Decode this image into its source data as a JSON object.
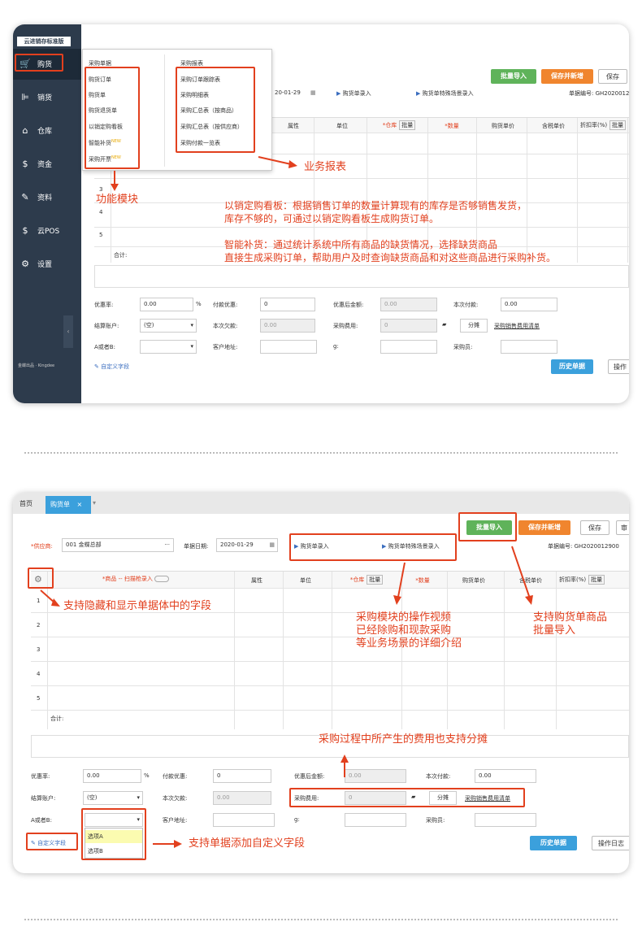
{
  "card1": {
    "brand": "云进销存标准版",
    "nav": [
      {
        "label": "购货",
        "icon": "cart-icon"
      },
      {
        "label": "销货",
        "icon": "sales-icon"
      },
      {
        "label": "仓库",
        "icon": "warehouse-icon"
      },
      {
        "label": "资金",
        "icon": "money-icon"
      },
      {
        "label": "资料",
        "icon": "pencil-icon"
      },
      {
        "label": "云POS",
        "icon": "pos-icon"
      },
      {
        "label": "设置",
        "icon": "gear-icon"
      }
    ],
    "footer": "金蝶出品 · Kingdee",
    "menu": {
      "col1_title": "采购单据",
      "col1": [
        "购货订单",
        "购货单",
        "购货退货单",
        "以销定购看板",
        "智能补货",
        "采购开票"
      ],
      "new": "NEW",
      "col2_title": "采购报表",
      "col2": [
        "采购订单跟踪表",
        "采购明细表",
        "采购汇总表（按商品）",
        "采购汇总表（按供应商）",
        "采购付款一览表"
      ]
    },
    "buttons": {
      "import": "批量导入",
      "save_new": "保存并新增",
      "save": "保存",
      "history": "历史单据",
      "op": "操作"
    },
    "date": "20-01-29",
    "video1": "购货单录入",
    "video2": "购货单特殊场景录入",
    "docno": "单据编号:  GH2020012",
    "columns": [
      "属性",
      "单位",
      "*仓库",
      "*数量",
      "购货单价",
      "含税单价",
      "折扣率(%)"
    ],
    "batch": "批量",
    "rows": [
      "3",
      "4",
      "5"
    ],
    "total": "合计:",
    "footer_form": {
      "discount_label": "优惠率:",
      "discount": "0.00",
      "pct": "%",
      "pay_disc_label": "付款优惠:",
      "pay_disc": "0",
      "after_label": "优惠后金额:",
      "after": "0.00",
      "this_pay_label": "本次付款:",
      "this_pay": "0.00",
      "account_label": "结算账户:",
      "account": "(空)",
      "owe_label": "本次欠款:",
      "owe": "0.00",
      "fee_label": "采购费用:",
      "fee": "0",
      "split": "分摊",
      "fee_list": "采购销售费用清单",
      "ab_label": "A或者B:",
      "addr_label": "客户地址:",
      "g_label": "g:",
      "buyer_label": "采购员:",
      "custom": "自定义字段"
    },
    "ann": {
      "func": "功能模块",
      "report": "业务报表",
      "p1": "以销定购看板：根据销售订单的数量计算现有的库存是否够销售发货，",
      "p2": "库存不够的，可通过以销定购看板生成购货订单。",
      "p3": "智能补货：通过统计系统中所有商品的缺货情况，选择缺货商品",
      "p4": "直接生成采购订单，帮助用户及时查询缺货商品和对这些商品进行采购补货。"
    }
  },
  "card2": {
    "tabs": [
      "首页",
      "购货单"
    ],
    "close": "×",
    "buttons": {
      "import": "批量导入",
      "save_new": "保存并新增",
      "save": "保存",
      "more": "审",
      "history": "历史单据",
      "log": "操作日志"
    },
    "supplier_label": "*供应商:",
    "supplier": "001 金蝶总部",
    "dots": "···",
    "date_label": "单据日期:",
    "date": "2020-01-29",
    "video1": "购货单录入",
    "video2": "购货单特殊场景录入",
    "docno": "单据编号:  GH2020012900",
    "columns": [
      "*商品 -- 扫描枪录入",
      "属性",
      "单位",
      "*仓库",
      "*数量",
      "购货单价",
      "含税单价",
      "折扣率(%)"
    ],
    "batch": "批量",
    "rows": [
      "1",
      "2",
      "3",
      "4",
      "5"
    ],
    "total": "合计:",
    "footer_form": {
      "discount_label": "优惠率:",
      "discount": "0.00",
      "pct": "%",
      "pay_disc_label": "付款优惠:",
      "pay_disc": "0",
      "after_label": "优惠后金额:",
      "after": "0.00",
      "this_pay_label": "本次付款:",
      "this_pay": "0.00",
      "account_label": "结算账户:",
      "account": "(空)",
      "owe_label": "本次欠款:",
      "owe": "0.00",
      "fee_label": "采购费用:",
      "fee": "0",
      "split": "分摊",
      "fee_list": "采购销售费用清单",
      "ab_label": "A或者B:",
      "addr_label": "客户地址:",
      "g_label": "g:",
      "buyer_label": "采购员:",
      "custom": "自定义字段",
      "optA": "选项A",
      "optB": "选项B"
    },
    "ann": {
      "hide": "支持隐藏和显示单据体中的字段",
      "video1": "采购模块的操作视频",
      "video2": "已经除购和现款采购",
      "video3": "等业务场景的详细介绍",
      "import1": "支持购货单商品",
      "import2": "批量导入",
      "fee": "采购过程中所产生的费用也支持分摊",
      "custom": "支持单据添加自定义字段"
    }
  },
  "colors": {
    "accent_red": "#e2401e",
    "sidebar": "#2d3b4c",
    "green": "#5fb35a",
    "orange": "#f0852e",
    "blue": "#3ba0dc"
  }
}
